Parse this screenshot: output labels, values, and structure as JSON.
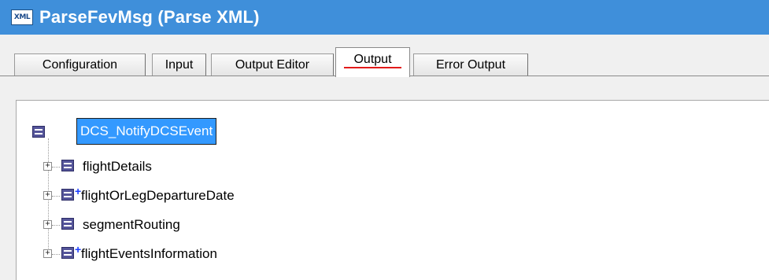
{
  "window": {
    "badge": "XML",
    "title": "ParseFevMsg (Parse XML)"
  },
  "tabs": [
    {
      "label": "Configuration",
      "active": false
    },
    {
      "label": "Input",
      "active": false
    },
    {
      "label": "Output Editor",
      "active": false
    },
    {
      "label": "Output",
      "active": true
    },
    {
      "label": "Error Output",
      "active": false
    }
  ],
  "tree": {
    "root": "DCS_NotifyDCSEvent",
    "children": [
      {
        "label": "flightDetails",
        "repeatable": false
      },
      {
        "label": "flightOrLegDepartureDate",
        "repeatable": true,
        "marker": "+"
      },
      {
        "label": "segmentRouting",
        "repeatable": false
      },
      {
        "label": "flightEventsInformation",
        "repeatable": true,
        "marker": "+"
      }
    ],
    "expander_symbol": "+"
  },
  "colors": {
    "titlebar": "#3f8fda",
    "selection": "#3399ff",
    "active_tab_underline": "#e21b1b",
    "node_icon": "#55559a",
    "repeat_marker": "#1a3cff"
  }
}
